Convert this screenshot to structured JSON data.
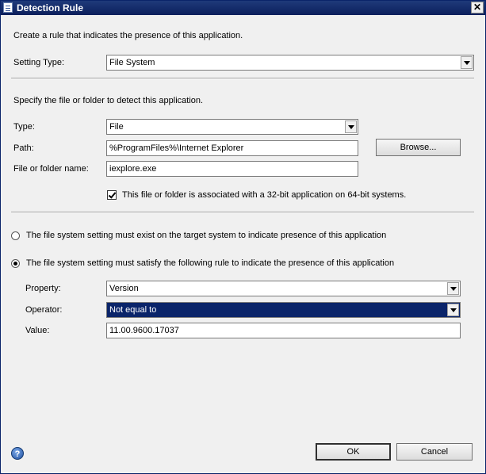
{
  "window": {
    "title": "Detection Rule",
    "close_glyph": "✕"
  },
  "intro": "Create a rule that indicates the presence of this application.",
  "setting_type": {
    "label": "Setting Type:",
    "value": "File System"
  },
  "specify_text": "Specify the file or folder to detect this application.",
  "type": {
    "label": "Type:",
    "value": "File"
  },
  "path": {
    "label": "Path:",
    "value": "%ProgramFiles%\\Internet Explorer"
  },
  "browse_label": "Browse...",
  "name": {
    "label": "File or folder name:",
    "value": "iexplore.exe"
  },
  "checkbox_32bit": {
    "label": "This file or folder is associated with a 32-bit application on 64-bit systems.",
    "checked": true
  },
  "radio_exist": {
    "label": "The file system setting must exist on the target system to indicate presence of this application",
    "selected": false
  },
  "radio_rule": {
    "label": "The file system setting must satisfy the following rule to indicate the presence of this application",
    "selected": true
  },
  "property": {
    "label": "Property:",
    "value": "Version"
  },
  "operator": {
    "label": "Operator:",
    "value": "Not equal to"
  },
  "value": {
    "label": "Value:",
    "value": "11.00.9600.17037"
  },
  "buttons": {
    "ok": "OK",
    "cancel": "Cancel",
    "help": "?"
  },
  "colors": {
    "title_bar": "#0b1f5c",
    "selection": "#0a246a",
    "help_icon": "#1f4f9f"
  }
}
